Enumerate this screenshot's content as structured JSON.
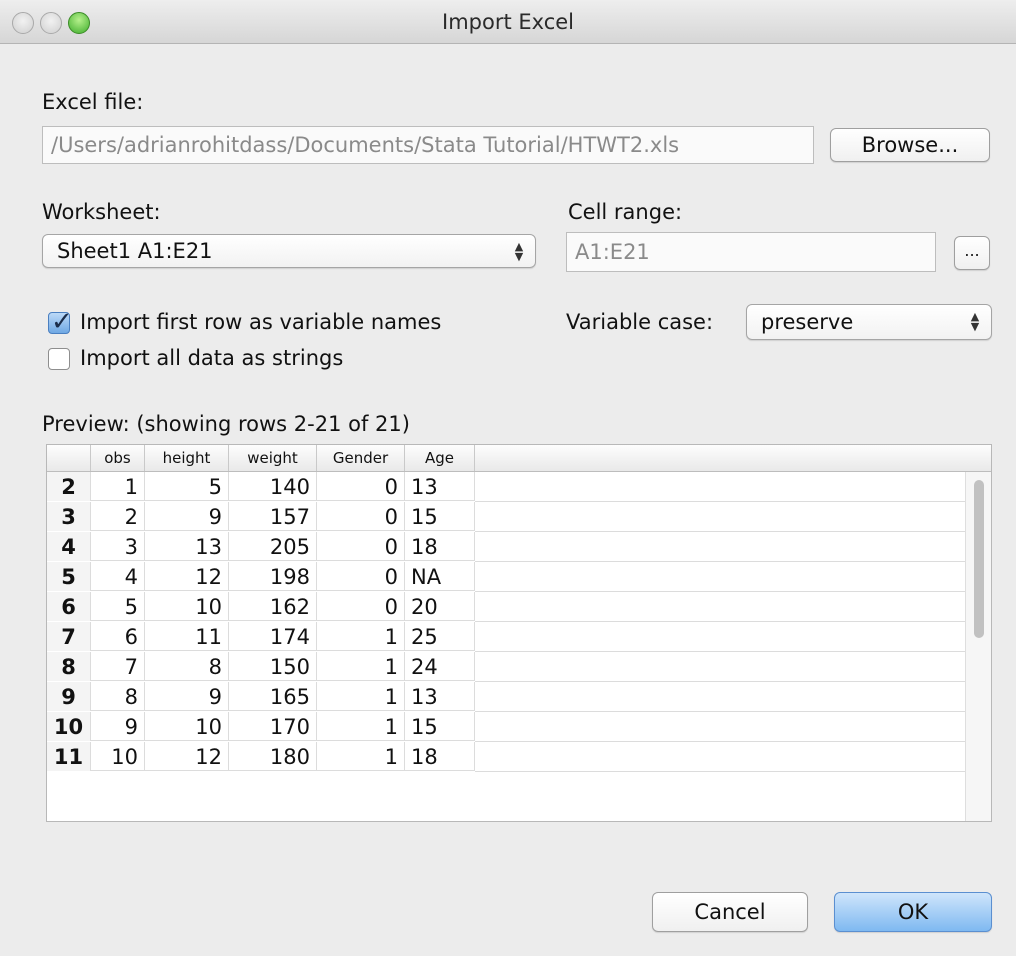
{
  "window": {
    "title": "Import Excel"
  },
  "excel_file": {
    "label": "Excel file:",
    "path": "/Users/adrianrohitdass/Documents/Stata Tutorial/HTWT2.xls",
    "browse_label": "Browse..."
  },
  "worksheet": {
    "label": "Worksheet:",
    "selected": "Sheet1 A1:E21"
  },
  "cell_range": {
    "label": "Cell range:",
    "value": "A1:E21",
    "button_label": "..."
  },
  "options": {
    "first_row_label": "Import first row as variable names",
    "first_row_checked": true,
    "strings_label": "Import all data as strings",
    "strings_checked": false
  },
  "variable_case": {
    "label": "Variable case:",
    "selected": "preserve"
  },
  "preview": {
    "label": "Preview: (showing rows 2-21 of 21)",
    "columns": [
      "",
      "obs",
      "height",
      "weight",
      "Gender",
      "Age"
    ],
    "rows": [
      [
        "2",
        "1",
        "5",
        "140",
        "0",
        "13"
      ],
      [
        "3",
        "2",
        "9",
        "157",
        "0",
        "15"
      ],
      [
        "4",
        "3",
        "13",
        "205",
        "0",
        "18"
      ],
      [
        "5",
        "4",
        "12",
        "198",
        "0",
        "NA"
      ],
      [
        "6",
        "5",
        "10",
        "162",
        "0",
        "20"
      ],
      [
        "7",
        "6",
        "11",
        "174",
        "1",
        "25"
      ],
      [
        "8",
        "7",
        "8",
        "150",
        "1",
        "24"
      ],
      [
        "9",
        "8",
        "9",
        "165",
        "1",
        "13"
      ],
      [
        "10",
        "9",
        "10",
        "170",
        "1",
        "15"
      ],
      [
        "11",
        "10",
        "12",
        "180",
        "1",
        "18"
      ]
    ]
  },
  "buttons": {
    "cancel": "Cancel",
    "ok": "OK"
  },
  "colors": {
    "default_button": "#7fb9f1",
    "window_bg": "#ececec"
  }
}
